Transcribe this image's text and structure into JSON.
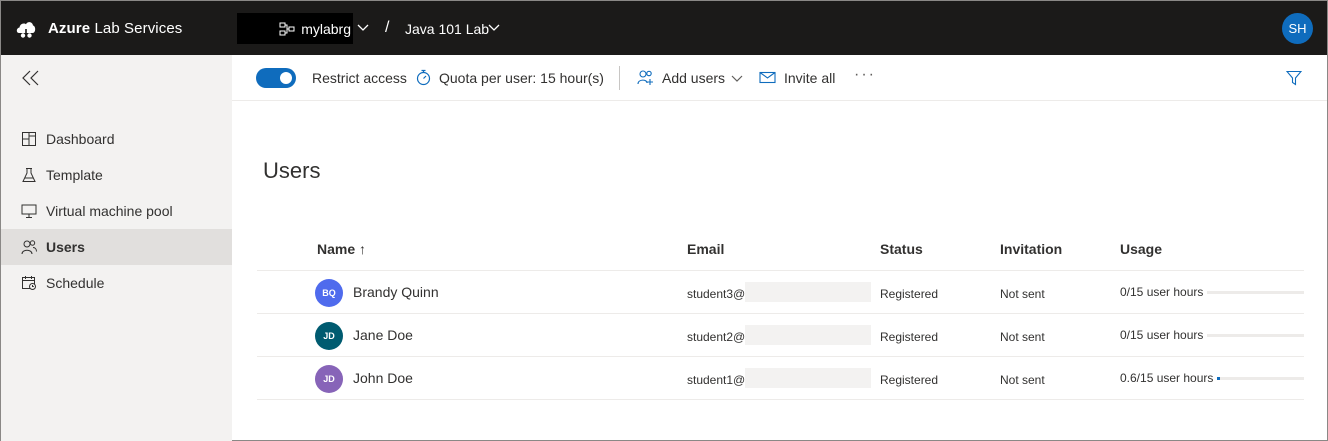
{
  "header": {
    "brand_bold": "Azure",
    "brand_rest": " Lab Services",
    "resource_group": "mylabrg",
    "separator": "/",
    "lab_name": "Java 101 Lab",
    "user_initials": "SH"
  },
  "sidebar": {
    "items": [
      {
        "label": "Dashboard",
        "icon": "dashboard-icon",
        "active": false
      },
      {
        "label": "Template",
        "icon": "flask-icon",
        "active": false
      },
      {
        "label": "Virtual machine pool",
        "icon": "monitor-icon",
        "active": false
      },
      {
        "label": "Users",
        "icon": "users-icon",
        "active": true
      },
      {
        "label": "Schedule",
        "icon": "calendar-icon",
        "active": false
      }
    ]
  },
  "toolbar": {
    "restrict_access_label": "Restrict access",
    "restrict_access_on": true,
    "quota_label": "Quota per user: 15 hour(s)",
    "add_users_label": "Add users",
    "invite_all_label": "Invite all",
    "more_label": "···"
  },
  "main": {
    "title": "Users",
    "columns": {
      "name": "Name ↑",
      "email": "Email",
      "status": "Status",
      "invitation": "Invitation",
      "usage": "Usage"
    },
    "rows": [
      {
        "initials": "BQ",
        "name": "Brandy Quinn",
        "email": "student3@",
        "status": "Registered",
        "invitation": "Not sent",
        "usage": "0/15 user hours",
        "usage_fraction": 0.0,
        "avatar_color": "#4f6bed"
      },
      {
        "initials": "JD",
        "name": "Jane Doe",
        "email": "student2@",
        "status": "Registered",
        "invitation": "Not sent",
        "usage": "0/15 user hours",
        "usage_fraction": 0.0,
        "avatar_color": "#005b70"
      },
      {
        "initials": "JD",
        "name": "John Doe",
        "email": "student1@",
        "status": "Registered",
        "invitation": "Not sent",
        "usage": "0.6/15 user hours",
        "usage_fraction": 0.04,
        "avatar_color": "#8764b8"
      }
    ]
  },
  "colors": {
    "accent": "#0f6cbd",
    "topbar": "#1b1a19",
    "sidebar": "#f3f2f1"
  }
}
